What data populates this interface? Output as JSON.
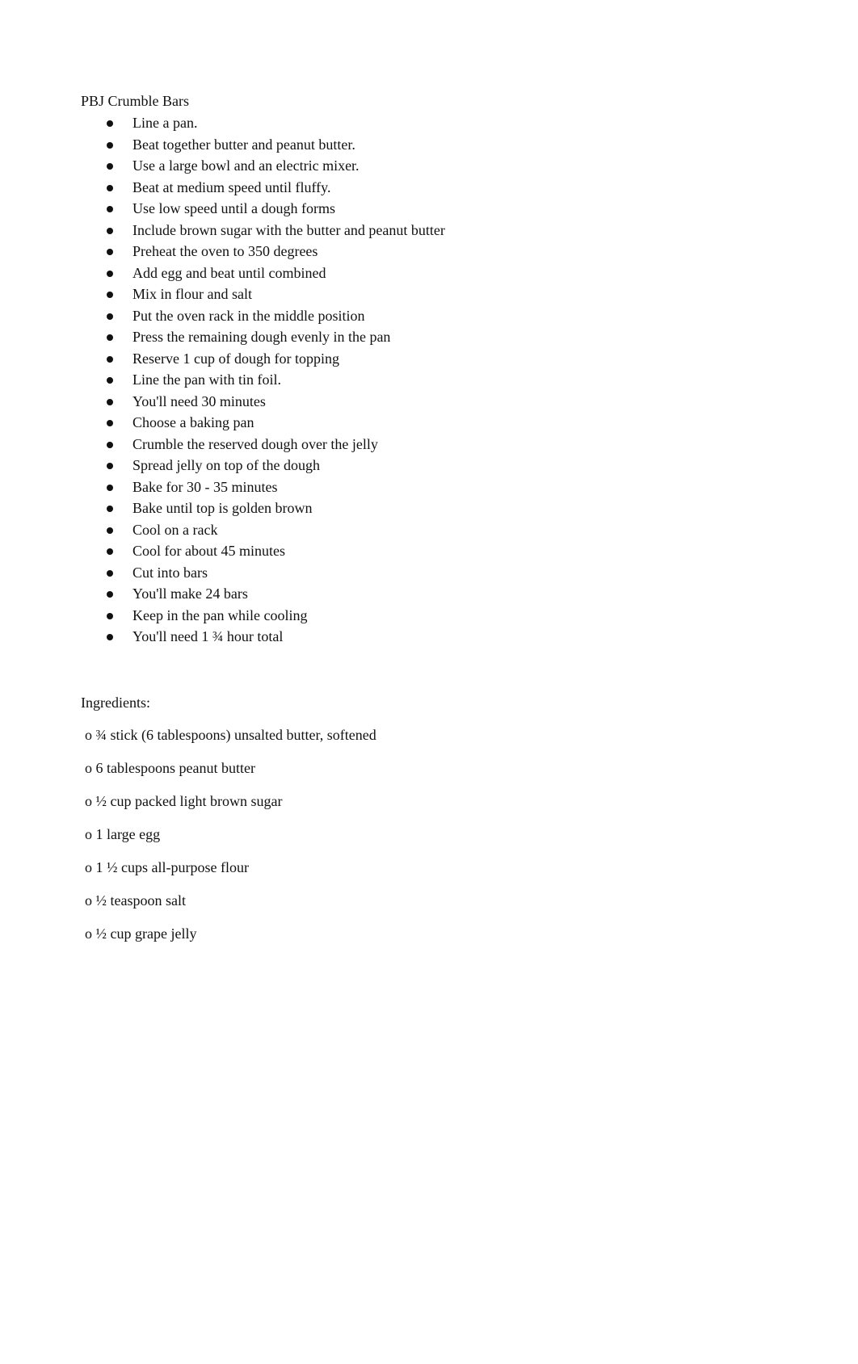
{
  "document": {
    "title": "PBJ Crumble Bars",
    "steps": [
      "Line a pan.",
      "Beat together butter and peanut butter.",
      "Use a large bowl and an electric mixer.",
      "Beat at medium speed until fluffy.",
      "Use low speed until a dough forms",
      "Include brown sugar with the butter and peanut butter",
      "Preheat the oven to 350 degrees",
      "Add egg and beat until combined",
      "Mix in flour and salt",
      "Put the oven rack in the middle position",
      "Press the remaining dough evenly in the pan",
      "Reserve 1 cup of dough for topping",
      "Line the pan with tin foil.",
      "You'll need 30 minutes",
      "Choose a baking pan",
      "Crumble the reserved dough over the jelly",
      "Spread jelly on top of the dough",
      "Bake for 30 - 35 minutes",
      "Bake until top is golden brown",
      "Cool on a rack",
      "Cool for about 45 minutes",
      "Cut into bars",
      "You'll make 24 bars",
      "Keep in the pan while cooling",
      "You'll need 1 ¾ hour total"
    ],
    "ingredients_title": "Ingredients:",
    "ingredients": [
      "o ¾ stick (6 tablespoons) unsalted butter, softened",
      "o 6 tablespoons peanut butter",
      "o ½ cup packed light brown sugar",
      "o 1 large egg",
      "o 1 ½ cups all-purpose flour",
      "o ½ teaspoon salt",
      "o ½ cup grape jelly"
    ]
  }
}
